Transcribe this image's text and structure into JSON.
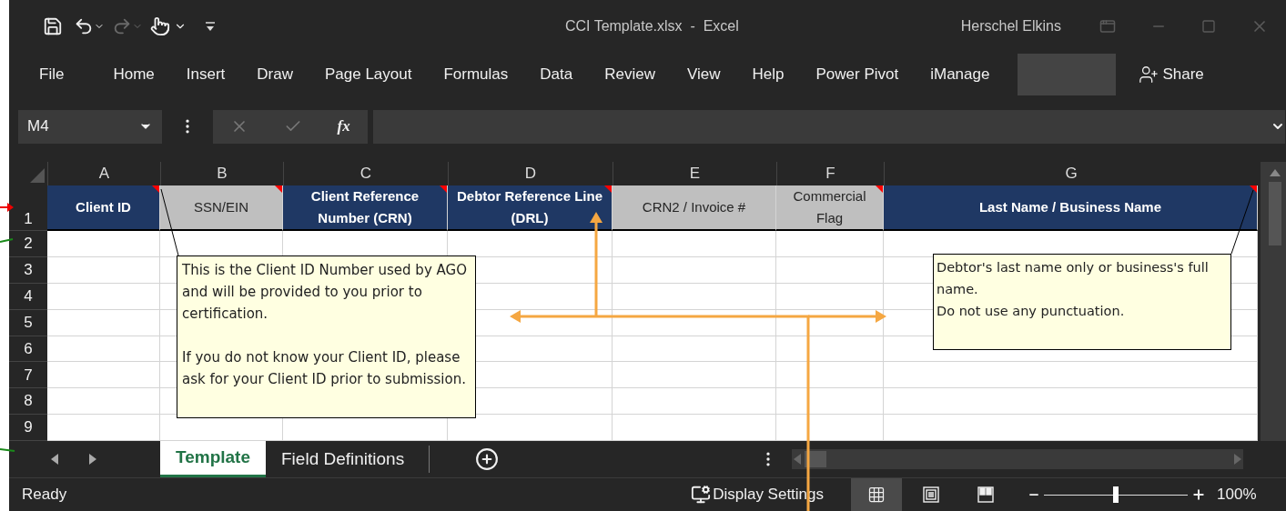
{
  "window": {
    "title": "CCI Template.xlsx  -  Excel",
    "user": "Herschel Elkins"
  },
  "ribbon_tabs": [
    "File",
    "Home",
    "Insert",
    "Draw",
    "Page Layout",
    "Formulas",
    "Data",
    "Review",
    "View",
    "Help",
    "Power Pivot",
    "iManage"
  ],
  "share_button": "Share",
  "formula_bar": {
    "name_box": "M4",
    "function_button": "fx"
  },
  "columns": [
    "A",
    "B",
    "C",
    "D",
    "E",
    "F",
    "G"
  ],
  "row_numbers": [
    "1",
    "2",
    "3",
    "4",
    "5",
    "6",
    "7",
    "8",
    "9"
  ],
  "header_cells": [
    {
      "text": "Client ID",
      "kind": "required",
      "has_comment": true
    },
    {
      "text": "SSN/EIN",
      "kind": "optional",
      "has_comment": true
    },
    {
      "text": "Client Reference Number (CRN)",
      "kind": "required",
      "has_comment": true
    },
    {
      "text": "Debtor Reference Line (DRL)",
      "kind": "required",
      "has_comment": true
    },
    {
      "text": "CRN2 / Invoice #",
      "kind": "optional",
      "has_comment": false
    },
    {
      "text": "Commercial Flag",
      "kind": "optional",
      "has_comment": true
    },
    {
      "text": "Last Name / Business Name",
      "kind": "required",
      "has_comment": true
    }
  ],
  "comments": [
    {
      "text": "This is the Client ID Number used by AGO and will be provided to you prior to certification.\n\nIf you do not know your Client ID, please ask for your Client ID prior to submission."
    },
    {
      "text": "Debtor's last name only or business's full name.\nDo not use any punctuation."
    }
  ],
  "sheet_tabs": [
    {
      "label": "Template",
      "selected": true
    },
    {
      "label": "Field Definitions",
      "selected": false
    }
  ],
  "status_bar": {
    "status": "Ready",
    "display_settings": "Display Settings",
    "views": [
      {
        "kind": "normal",
        "selected": true
      },
      {
        "kind": "page_layout",
        "selected": false
      },
      {
        "kind": "page_break",
        "selected": false
      }
    ],
    "zoom": {
      "level": 0.5,
      "reading": "100%"
    }
  }
}
